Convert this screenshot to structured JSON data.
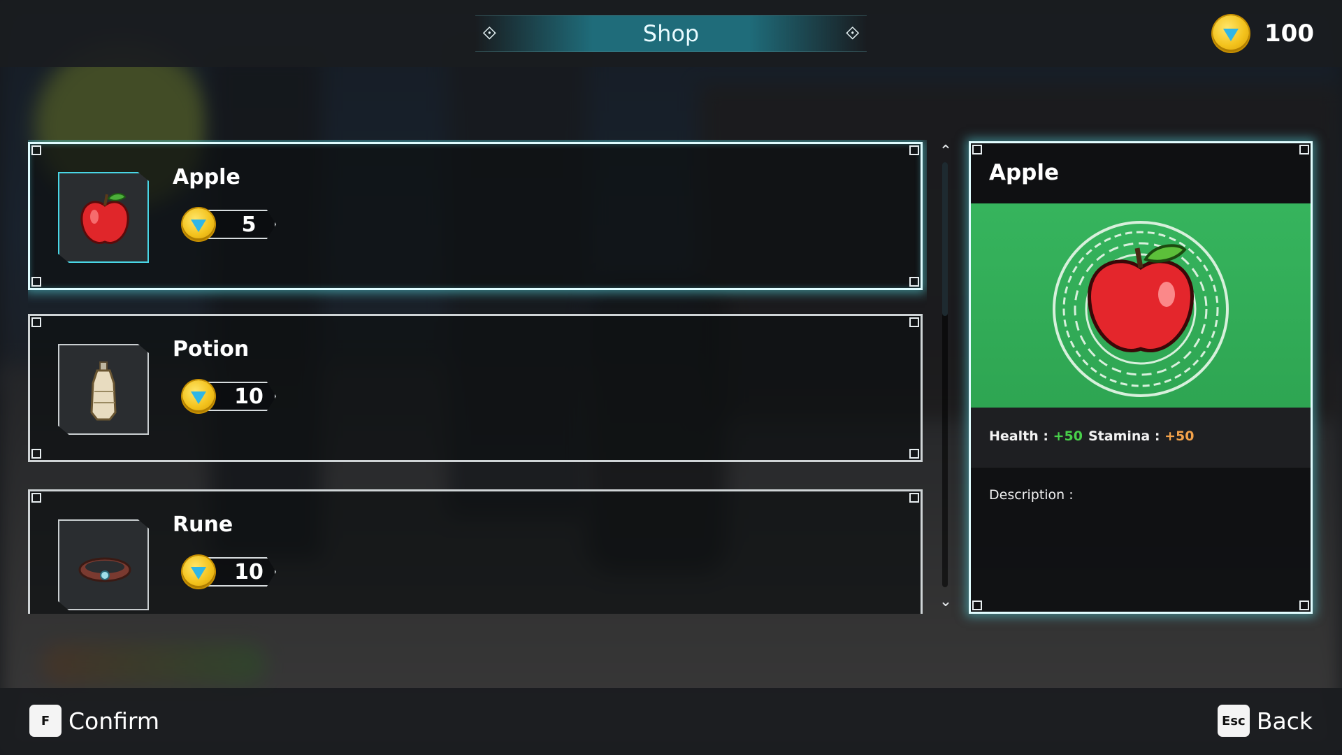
{
  "header": {
    "title": "Shop",
    "currency_amount": "100",
    "currency_icon": "gem-coin-icon"
  },
  "items": [
    {
      "name": "Apple",
      "price": "5",
      "icon": "apple-icon",
      "selected": true
    },
    {
      "name": "Potion",
      "price": "10",
      "icon": "potion-bottle-icon",
      "selected": false
    },
    {
      "name": "Rune",
      "price": "10",
      "icon": "rune-bracelet-icon",
      "selected": false
    }
  ],
  "detail": {
    "title": "Apple",
    "health_label": "Health : ",
    "health_value": "+50",
    "stamina_label": "Stamina : ",
    "stamina_value": "+50",
    "description_label": "Description :"
  },
  "footer": {
    "confirm_key": "F",
    "confirm_label": "Confirm",
    "back_key": "Esc",
    "back_label": "Back"
  },
  "colors": {
    "accent": "#5adce6",
    "banner_green": "#36b45d",
    "health": "#48d04a",
    "stamina": "#f3a24a",
    "coin": "#f3c21c"
  }
}
